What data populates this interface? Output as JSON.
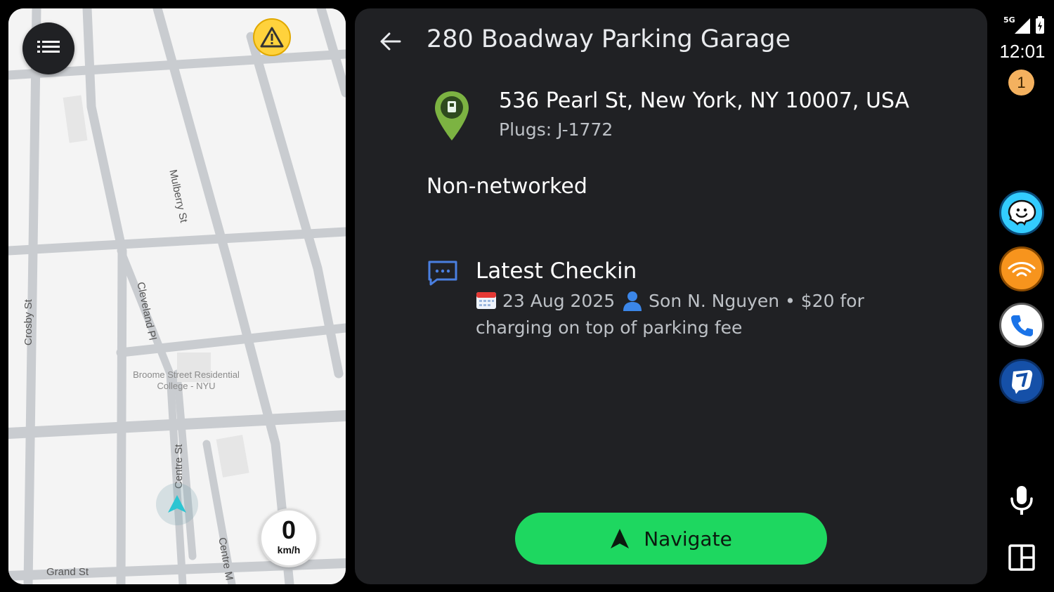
{
  "map": {
    "speed_value": "0",
    "speed_unit": "km/h",
    "streets": {
      "mulberry": "Mulberry St",
      "cleveland": "Cleveland Pl",
      "crosby": "Crosby St",
      "centre1": "Centre St",
      "centre2": "Centre M",
      "grand": "Grand St"
    },
    "poi_line1": "Broome Street Residential",
    "poi_line2": "College - NYU"
  },
  "details": {
    "title": "280 Boadway Parking Garage",
    "address": "536 Pearl St, New York, NY 10007, USA",
    "plugs": "Plugs: J-1772",
    "network": "Non-networked",
    "checkin_title": "Latest Checkin",
    "checkin_date": "23 Aug 2025",
    "checkin_user": "Son N. Nguyen",
    "checkin_text": "• $20 for charging on top of parking fee",
    "navigate_label": "Navigate"
  },
  "rail": {
    "signal_label": "5G",
    "time": "12:01",
    "notification_count": "1"
  },
  "colors": {
    "accent_green": "#1ed760",
    "panel_bg": "#202124",
    "waze_blue": "#33ccff",
    "audible_orange": "#f7941d"
  }
}
